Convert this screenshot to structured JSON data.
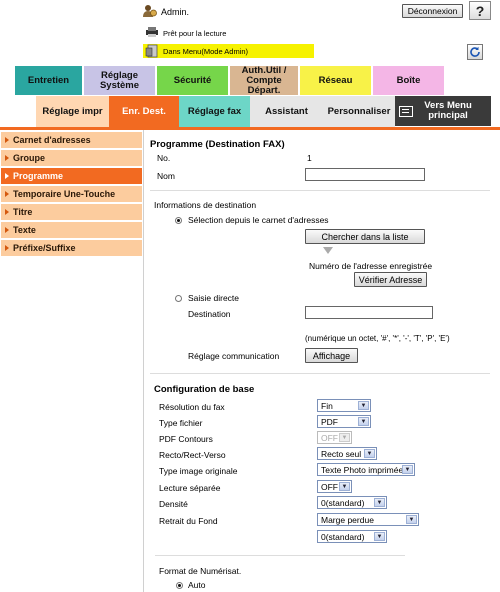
{
  "header": {
    "user_label": "Admin.",
    "logout_button": "Déconnexion",
    "help_label": "?",
    "status_text": "Prêt pour la lecture",
    "mode_text": "Dans Menu(Mode Admin)"
  },
  "tabs": [
    "Entretien",
    "Réglage Système",
    "Sécurité",
    "Auth.Util / Compte Départ.",
    "Réseau",
    "Boîte"
  ],
  "subtabs": [
    "Réglage impr",
    "Enr. Dest.",
    "Réglage fax",
    "Assistant",
    "Personnaliser"
  ],
  "main_menu_button": "Vers Menu principal",
  "sidebar": [
    "Carnet d'adresses",
    "Groupe",
    "Programme",
    "Temporaire Une-Touche",
    "Titre",
    "Texte",
    "Préfixe/Suffixe"
  ],
  "form": {
    "title": "Programme (Destination FAX)",
    "no_label": "No.",
    "no_value": "1",
    "name_label": "Nom",
    "dest_info_label": "Informations de destination",
    "radio_addressbook": "Sélection depuis le carnet d'adresses",
    "search_button": "Chercher dans la liste",
    "registered_number_label": "Numéro de l'adresse enregistrée",
    "verify_button": "Vérifier Adresse",
    "radio_direct": "Saisie directe",
    "destination_label": "Destination",
    "destination_hint": "(numérique un octet, '#', '*', '-', 'T', 'P', 'E')",
    "comm_setting_label": "Réglage communication",
    "display_button": "Affichage"
  },
  "config": {
    "title": "Configuration de base",
    "rows": [
      {
        "label": "Résolution du fax",
        "value": "Fin"
      },
      {
        "label": "Type fichier",
        "value": "PDF"
      },
      {
        "label": "PDF Contours",
        "value": "OFF"
      },
      {
        "label": "Recto/Rect-Verso",
        "value": "Recto seul"
      },
      {
        "label": "Type image originale",
        "value": "Texte Photo imprimée"
      },
      {
        "label": "Lecture séparée",
        "value": "OFF"
      },
      {
        "label": "Densité",
        "value": "0(standard)"
      },
      {
        "label": "Retrait du Fond",
        "value": "Marge perdue"
      },
      {
        "label": "",
        "value": "0(standard)"
      }
    ],
    "scan_format_label": "Format de Numérisat.",
    "scan_format_auto": "Auto"
  },
  "colors": {
    "tab_teal": "#2aa6a0",
    "tab_lavender": "#c8c4e6",
    "tab_green": "#76d64a",
    "tab_tan": "#d9b692",
    "tab_yellow": "#f8f248",
    "tab_pink": "#f4b6e6",
    "accent_orange": "#f26a21",
    "sidebar_peach": "#fccc9e",
    "mode_yellow": "#f6f200"
  }
}
